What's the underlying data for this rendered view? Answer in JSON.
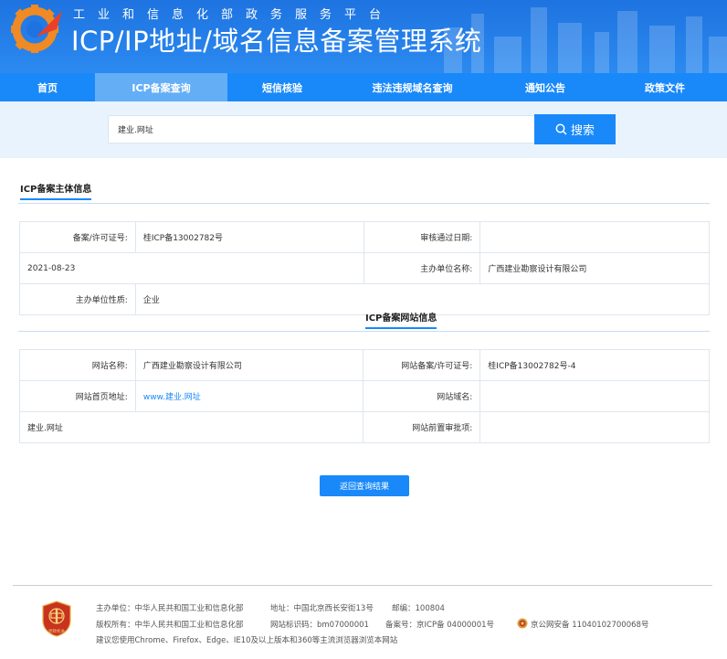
{
  "header": {
    "subtitle": "工业和信息化部政务服务平台",
    "title": "ICP/IP地址/域名信息备案管理系统"
  },
  "nav": [
    {
      "label": "首页",
      "active": false
    },
    {
      "label": "ICP备案查询",
      "active": true
    },
    {
      "label": "短信核验",
      "active": false
    },
    {
      "label": "违法违规域名查询",
      "active": false
    },
    {
      "label": "通知公告",
      "active": false
    },
    {
      "label": "政策文件",
      "active": false
    }
  ],
  "search": {
    "value": "建业.网址",
    "button": "搜索"
  },
  "subject": {
    "section_title": "ICP备案主体信息",
    "license_label": "备案/许可证号:",
    "license_value": "桂ICP备13002782号",
    "approve_date_label": "审核通过日期:",
    "approve_date_value": "2021-08-23",
    "org_name_label": "主办单位名称:",
    "org_name_value": "广西建业勘察设计有限公司",
    "org_type_label": "主办单位性质:",
    "org_type_value": "企业"
  },
  "website": {
    "section_title": "ICP备案网站信息",
    "site_name_label": "网站名称:",
    "site_name_value": "广西建业勘察设计有限公司",
    "site_license_label": "网站备案/许可证号:",
    "site_license_value": "桂ICP备13002782号-4",
    "homepage_label": "网站首页地址:",
    "homepage_value": "www.建业.网址",
    "domain_label": "网站域名:",
    "domain_value": "建业.网址",
    "preapproval_label": "网站前置审批项:",
    "preapproval_value": ""
  },
  "back_button": "返回查询结果",
  "footer": {
    "line1_org": "主办单位：中华人民共和国工业和信息化部",
    "line1_addr": "地址：中国北京西长安街13号",
    "line1_zip": "邮编：100804",
    "line2_copy": "版权所有：中华人民共和国工业和信息化部",
    "line2_siteid": "网站标识码：bm07000001",
    "line2_icp": "备案号：京ICP备 04000001号",
    "line2_police": "京公网安备 11040102700068号",
    "line3": "建议您使用Chrome、Firefox、Edge、IE10及以上版本和360等主流浏览器浏览本网站",
    "badge_text": "党政机关"
  },
  "colors": {
    "primary": "#1989fa",
    "header_dark": "#1e73e0",
    "search_bg": "#e8f3fd"
  }
}
